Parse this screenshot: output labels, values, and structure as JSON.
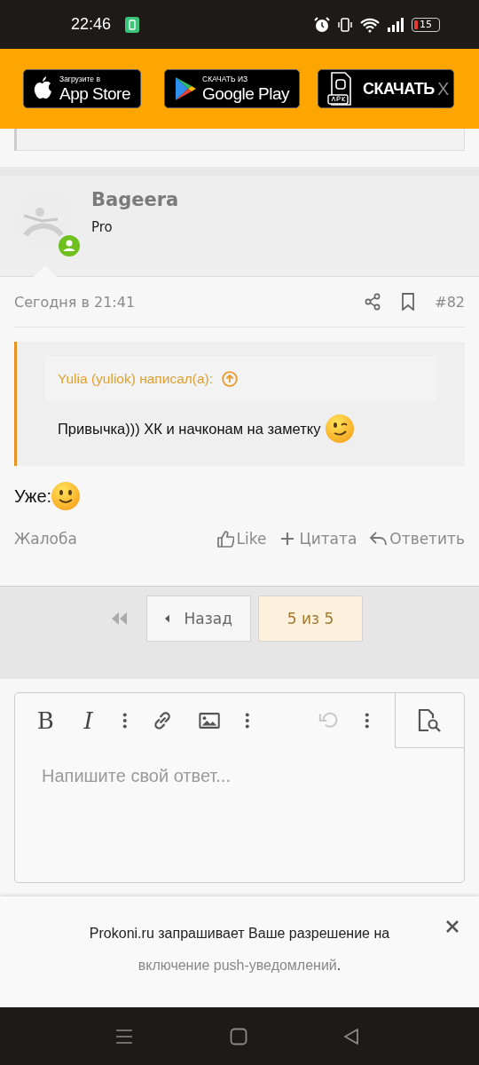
{
  "status_bar": {
    "time": "22:46",
    "battery": "15"
  },
  "app_banner": {
    "buttons": [
      {
        "kind": "appstore",
        "caption": "Загрузите в",
        "label": "App Store"
      },
      {
        "kind": "googleplay",
        "caption": "СКАЧАТЬ ИЗ",
        "label": "Google Play"
      },
      {
        "kind": "apk",
        "label": "СКАЧАТЬ"
      }
    ],
    "close": "X"
  },
  "post": {
    "author": "Bageera",
    "rank": "Pro",
    "online": true,
    "date": "Сегодня в 21:41",
    "number": "#82",
    "quote": {
      "author": "Yulia (yuliok) написал(а):",
      "text": "Привычка))) ХК и начконам на заметку"
    },
    "text": "Уже:",
    "report": "Жалоба",
    "actions": [
      {
        "kind": "like",
        "label": "Like"
      },
      {
        "kind": "quote",
        "label": "Цитата"
      },
      {
        "kind": "reply",
        "label": "Ответить"
      }
    ]
  },
  "pagination": {
    "prev": "Назад",
    "current": "5 из 5"
  },
  "editor": {
    "tools": [
      {
        "kind": "bold",
        "glyph": "B",
        "disabled": false
      },
      {
        "kind": "italic",
        "glyph": "I",
        "disabled": false
      },
      {
        "kind": "more",
        "disabled": false
      },
      {
        "kind": "link",
        "disabled": false
      },
      {
        "kind": "image",
        "disabled": false
      },
      {
        "kind": "more",
        "disabled": false
      },
      {
        "kind": "undo",
        "disabled": true
      },
      {
        "kind": "more",
        "disabled": false
      }
    ],
    "placeholder": "Напишите свой ответ..."
  },
  "push_prompt": {
    "text": "Prokoni.ru запрашивает Ваше разрешение на",
    "link": "включение push-уведомлений",
    "end": "."
  }
}
